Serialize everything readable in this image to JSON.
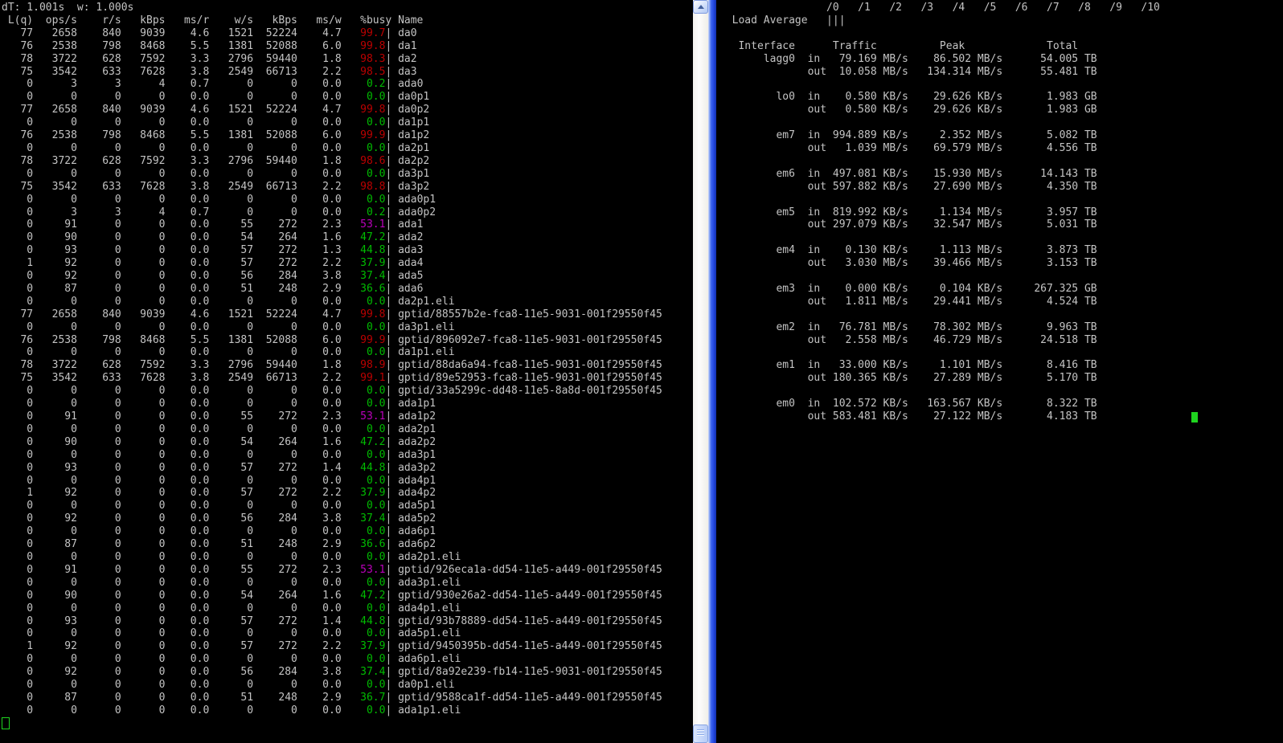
{
  "colors": {
    "foreground": "#c4c4c4",
    "background": "#000000",
    "busy_red": "#bb0000",
    "busy_green": "#00bb00",
    "busy_magenta": "#bb00bb",
    "cursor_green": "#1fd41f",
    "window_border_blue": "#2449e2"
  },
  "left_terminal": {
    "dt_line": "dT: 1.001s  w: 1.000s",
    "columns": [
      "L(q)",
      "ops/s",
      "r/s",
      "kBps",
      "ms/r",
      "w/s",
      "kBps",
      "ms/w",
      "%busy",
      "Name"
    ],
    "rows": [
      [
        77,
        2658,
        840,
        9039,
        "4.6",
        1521,
        52224,
        "4.7",
        "99.7",
        "da0"
      ],
      [
        76,
        2538,
        798,
        8468,
        "5.5",
        1381,
        52088,
        "6.0",
        "99.8",
        "da1"
      ],
      [
        78,
        3722,
        628,
        7592,
        "3.3",
        2796,
        59440,
        "1.8",
        "98.3",
        "da2"
      ],
      [
        75,
        3542,
        633,
        7628,
        "3.8",
        2549,
        66713,
        "2.2",
        "98.5",
        "da3"
      ],
      [
        0,
        3,
        3,
        4,
        "0.7",
        0,
        0,
        "0.0",
        "0.2",
        "ada0"
      ],
      [
        0,
        0,
        0,
        0,
        "0.0",
        0,
        0,
        "0.0",
        "0.0",
        "da0p1"
      ],
      [
        77,
        2658,
        840,
        9039,
        "4.6",
        1521,
        52224,
        "4.7",
        "99.8",
        "da0p2"
      ],
      [
        0,
        0,
        0,
        0,
        "0.0",
        0,
        0,
        "0.0",
        "0.0",
        "da1p1"
      ],
      [
        76,
        2538,
        798,
        8468,
        "5.5",
        1381,
        52088,
        "6.0",
        "99.9",
        "da1p2"
      ],
      [
        0,
        0,
        0,
        0,
        "0.0",
        0,
        0,
        "0.0",
        "0.0",
        "da2p1"
      ],
      [
        78,
        3722,
        628,
        7592,
        "3.3",
        2796,
        59440,
        "1.8",
        "98.6",
        "da2p2"
      ],
      [
        0,
        0,
        0,
        0,
        "0.0",
        0,
        0,
        "0.0",
        "0.0",
        "da3p1"
      ],
      [
        75,
        3542,
        633,
        7628,
        "3.8",
        2549,
        66713,
        "2.2",
        "98.8",
        "da3p2"
      ],
      [
        0,
        0,
        0,
        0,
        "0.0",
        0,
        0,
        "0.0",
        "0.0",
        "ada0p1"
      ],
      [
        0,
        3,
        3,
        4,
        "0.7",
        0,
        0,
        "0.0",
        "0.2",
        "ada0p2"
      ],
      [
        0,
        91,
        0,
        0,
        "0.0",
        55,
        272,
        "2.3",
        "53.1",
        "ada1"
      ],
      [
        0,
        90,
        0,
        0,
        "0.0",
        54,
        264,
        "1.6",
        "47.2",
        "ada2"
      ],
      [
        0,
        93,
        0,
        0,
        "0.0",
        57,
        272,
        "1.3",
        "44.8",
        "ada3"
      ],
      [
        1,
        92,
        0,
        0,
        "0.0",
        57,
        272,
        "2.2",
        "37.9",
        "ada4"
      ],
      [
        0,
        92,
        0,
        0,
        "0.0",
        56,
        284,
        "3.8",
        "37.4",
        "ada5"
      ],
      [
        0,
        87,
        0,
        0,
        "0.0",
        51,
        248,
        "2.9",
        "36.6",
        "ada6"
      ],
      [
        0,
        0,
        0,
        0,
        "0.0",
        0,
        0,
        "0.0",
        "0.0",
        "da2p1.eli"
      ],
      [
        77,
        2658,
        840,
        9039,
        "4.6",
        1521,
        52224,
        "4.7",
        "99.8",
        "gptid/88557b2e-fca8-11e5-9031-001f29550f45"
      ],
      [
        0,
        0,
        0,
        0,
        "0.0",
        0,
        0,
        "0.0",
        "0.0",
        "da3p1.eli"
      ],
      [
        76,
        2538,
        798,
        8468,
        "5.5",
        1381,
        52088,
        "6.0",
        "99.9",
        "gptid/896092e7-fca8-11e5-9031-001f29550f45"
      ],
      [
        0,
        0,
        0,
        0,
        "0.0",
        0,
        0,
        "0.0",
        "0.0",
        "da1p1.eli"
      ],
      [
        78,
        3722,
        628,
        7592,
        "3.3",
        2796,
        59440,
        "1.8",
        "98.9",
        "gptid/88da6a94-fca8-11e5-9031-001f29550f45"
      ],
      [
        75,
        3542,
        633,
        7628,
        "3.8",
        2549,
        66713,
        "2.2",
        "99.1",
        "gptid/89e52953-fca8-11e5-9031-001f29550f45"
      ],
      [
        0,
        0,
        0,
        0,
        "0.0",
        0,
        0,
        "0.0",
        "0.0",
        "gptid/33a5299c-dd48-11e5-8a8d-001f29550f45"
      ],
      [
        0,
        0,
        0,
        0,
        "0.0",
        0,
        0,
        "0.0",
        "0.0",
        "ada1p1"
      ],
      [
        0,
        91,
        0,
        0,
        "0.0",
        55,
        272,
        "2.3",
        "53.1",
        "ada1p2"
      ],
      [
        0,
        0,
        0,
        0,
        "0.0",
        0,
        0,
        "0.0",
        "0.0",
        "ada2p1"
      ],
      [
        0,
        90,
        0,
        0,
        "0.0",
        54,
        264,
        "1.6",
        "47.2",
        "ada2p2"
      ],
      [
        0,
        0,
        0,
        0,
        "0.0",
        0,
        0,
        "0.0",
        "0.0",
        "ada3p1"
      ],
      [
        0,
        93,
        0,
        0,
        "0.0",
        57,
        272,
        "1.4",
        "44.8",
        "ada3p2"
      ],
      [
        0,
        0,
        0,
        0,
        "0.0",
        0,
        0,
        "0.0",
        "0.0",
        "ada4p1"
      ],
      [
        1,
        92,
        0,
        0,
        "0.0",
        57,
        272,
        "2.2",
        "37.9",
        "ada4p2"
      ],
      [
        0,
        0,
        0,
        0,
        "0.0",
        0,
        0,
        "0.0",
        "0.0",
        "ada5p1"
      ],
      [
        0,
        92,
        0,
        0,
        "0.0",
        56,
        284,
        "3.8",
        "37.4",
        "ada5p2"
      ],
      [
        0,
        0,
        0,
        0,
        "0.0",
        0,
        0,
        "0.0",
        "0.0",
        "ada6p1"
      ],
      [
        0,
        87,
        0,
        0,
        "0.0",
        51,
        248,
        "2.9",
        "36.6",
        "ada6p2"
      ],
      [
        0,
        0,
        0,
        0,
        "0.0",
        0,
        0,
        "0.0",
        "0.0",
        "ada2p1.eli"
      ],
      [
        0,
        91,
        0,
        0,
        "0.0",
        55,
        272,
        "2.3",
        "53.1",
        "gptid/926eca1a-dd54-11e5-a449-001f29550f45"
      ],
      [
        0,
        0,
        0,
        0,
        "0.0",
        0,
        0,
        "0.0",
        "0.0",
        "ada3p1.eli"
      ],
      [
        0,
        90,
        0,
        0,
        "0.0",
        54,
        264,
        "1.6",
        "47.2",
        "gptid/930e26a2-dd54-11e5-a449-001f29550f45"
      ],
      [
        0,
        0,
        0,
        0,
        "0.0",
        0,
        0,
        "0.0",
        "0.0",
        "ada4p1.eli"
      ],
      [
        0,
        93,
        0,
        0,
        "0.0",
        57,
        272,
        "1.4",
        "44.8",
        "gptid/93b78889-dd54-11e5-a449-001f29550f45"
      ],
      [
        0,
        0,
        0,
        0,
        "0.0",
        0,
        0,
        "0.0",
        "0.0",
        "ada5p1.eli"
      ],
      [
        1,
        92,
        0,
        0,
        "0.0",
        57,
        272,
        "2.2",
        "37.9",
        "gptid/9450395b-dd54-11e5-a449-001f29550f45"
      ],
      [
        0,
        0,
        0,
        0,
        "0.0",
        0,
        0,
        "0.0",
        "0.0",
        "ada6p1.eli"
      ],
      [
        0,
        92,
        0,
        0,
        "0.0",
        56,
        284,
        "3.8",
        "37.4",
        "gptid/8a92e239-fb14-11e5-9031-001f29550f45"
      ],
      [
        0,
        0,
        0,
        0,
        "0.0",
        0,
        0,
        "0.0",
        "0.0",
        "da0p1.eli"
      ],
      [
        0,
        87,
        0,
        0,
        "0.0",
        51,
        248,
        "2.9",
        "36.7",
        "gptid/9588ca1f-dd54-11e5-a449-001f29550f45"
      ],
      [
        0,
        0,
        0,
        0,
        "0.0",
        0,
        0,
        "0.0",
        "0.0",
        "ada1p1.eli"
      ]
    ]
  },
  "right_terminal": {
    "ruler_marks": [
      "/0",
      "/1",
      "/2",
      "/3",
      "/4",
      "/5",
      "/6",
      "/7",
      "/8",
      "/9",
      "/10"
    ],
    "load_average_label": "Load Average",
    "load_average_bars": "|||",
    "columns": [
      "Interface",
      "Traffic",
      "Peak",
      "Total"
    ],
    "interfaces": [
      {
        "name": "lagg0",
        "in": {
          "traffic": "79.169 MB/s",
          "peak": "86.502 MB/s",
          "total": "54.005 TB"
        },
        "out": {
          "traffic": "10.058 MB/s",
          "peak": "134.314 MB/s",
          "total": "55.481 TB"
        }
      },
      {
        "name": "lo0",
        "in": {
          "traffic": "0.580 KB/s",
          "peak": "29.626 KB/s",
          "total": "1.983 GB"
        },
        "out": {
          "traffic": "0.580 KB/s",
          "peak": "29.626 KB/s",
          "total": "1.983 GB"
        }
      },
      {
        "name": "em7",
        "in": {
          "traffic": "994.889 KB/s",
          "peak": "2.352 MB/s",
          "total": "5.082 TB"
        },
        "out": {
          "traffic": "1.039 MB/s",
          "peak": "69.579 MB/s",
          "total": "4.556 TB"
        }
      },
      {
        "name": "em6",
        "in": {
          "traffic": "497.081 KB/s",
          "peak": "15.930 MB/s",
          "total": "14.143 TB"
        },
        "out": {
          "traffic": "597.882 KB/s",
          "peak": "27.690 MB/s",
          "total": "4.350 TB"
        }
      },
      {
        "name": "em5",
        "in": {
          "traffic": "819.992 KB/s",
          "peak": "1.134 MB/s",
          "total": "3.957 TB"
        },
        "out": {
          "traffic": "297.079 KB/s",
          "peak": "32.547 MB/s",
          "total": "5.031 TB"
        }
      },
      {
        "name": "em4",
        "in": {
          "traffic": "0.130 KB/s",
          "peak": "1.113 MB/s",
          "total": "3.873 TB"
        },
        "out": {
          "traffic": "3.030 MB/s",
          "peak": "39.466 MB/s",
          "total": "3.153 TB"
        }
      },
      {
        "name": "em3",
        "in": {
          "traffic": "0.000 KB/s",
          "peak": "0.104 KB/s",
          "total": "267.325 GB"
        },
        "out": {
          "traffic": "1.811 MB/s",
          "peak": "29.441 MB/s",
          "total": "4.524 TB"
        }
      },
      {
        "name": "em2",
        "in": {
          "traffic": "76.781 MB/s",
          "peak": "78.302 MB/s",
          "total": "9.963 TB"
        },
        "out": {
          "traffic": "2.558 MB/s",
          "peak": "46.729 MB/s",
          "total": "24.518 TB"
        }
      },
      {
        "name": "em1",
        "in": {
          "traffic": "33.000 KB/s",
          "peak": "1.101 MB/s",
          "total": "8.416 TB"
        },
        "out": {
          "traffic": "180.365 KB/s",
          "peak": "27.289 MB/s",
          "total": "5.170 TB"
        }
      },
      {
        "name": "em0",
        "in": {
          "traffic": "102.572 KB/s",
          "peak": "163.567 KB/s",
          "total": "8.322 TB"
        },
        "out": {
          "traffic": "583.481 KB/s",
          "peak": "27.122 MB/s",
          "total": "4.183 TB"
        }
      }
    ],
    "direction_labels": {
      "in": "in",
      "out": "out"
    }
  }
}
